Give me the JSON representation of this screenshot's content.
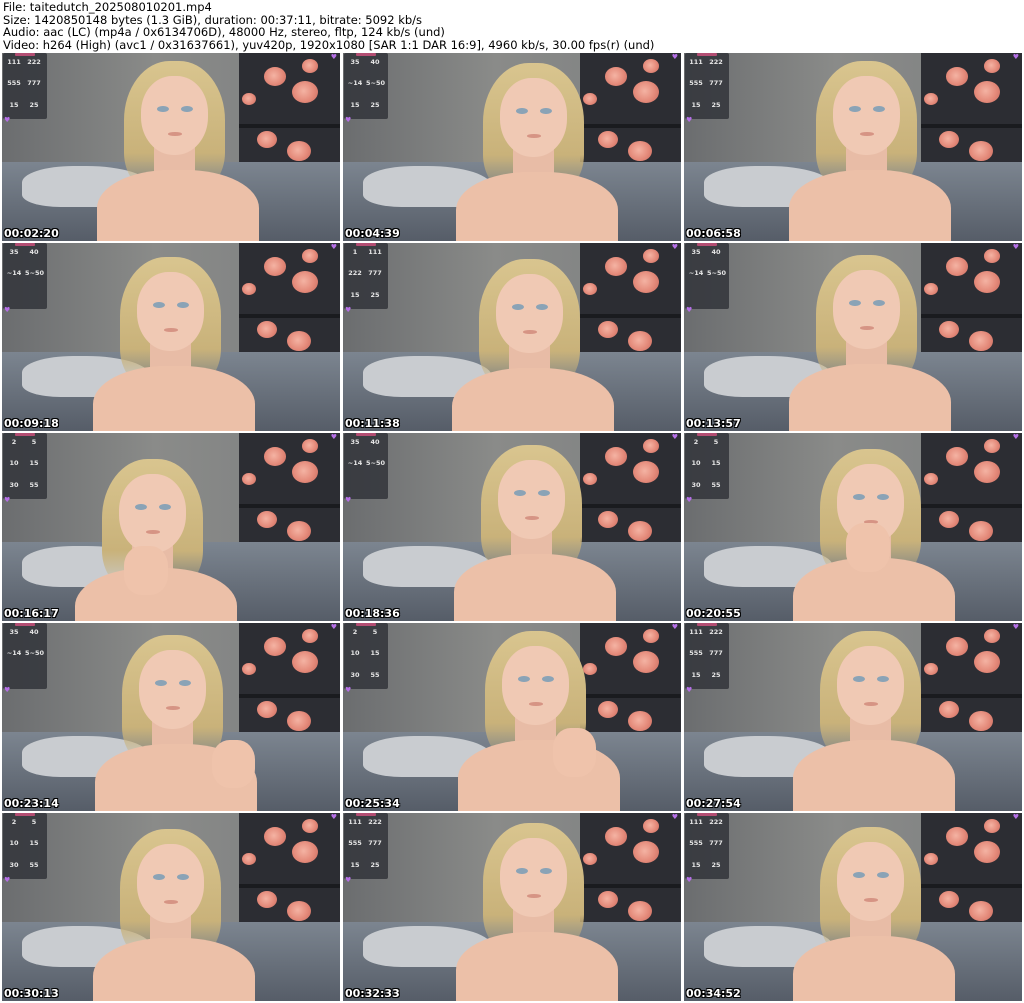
{
  "header": {
    "file": "File: taitedutch_202508010201.mp4",
    "size": "Size: 1420850148 bytes (1.3 GiB), duration: 00:37:11, bitrate: 5092 kb/s",
    "audio": "Audio: aac (LC) (mp4a / 0x6134706D), 48000 Hz, stereo, fltp, 124 kb/s (und)",
    "video": "Video: h264 (High) (avc1 / 0x31637661), yuv420p, 1920x1080 [SAR 1:1 DAR 16:9], 4960 kb/s, 30.00 fps(r) (und)"
  },
  "colors": {
    "timestamp": "#ffffff",
    "background": "#ffffff",
    "heart": "#b56fe6",
    "banner": "#b34e73"
  },
  "thumbnails": [
    {
      "time": "00:02:20",
      "panel": [
        "111",
        "222",
        "555",
        "777",
        "15",
        "25"
      ]
    },
    {
      "time": "00:04:39",
      "panel": [
        "35",
        "40",
        "~14",
        "5~50",
        "15",
        "25"
      ]
    },
    {
      "time": "00:06:58",
      "panel": [
        "111",
        "222",
        "555",
        "777",
        "15",
        "25"
      ]
    },
    {
      "time": "00:09:18",
      "panel": [
        "35",
        "40",
        "~14",
        "5~50",
        "",
        ""
      ]
    },
    {
      "time": "00:11:38",
      "panel": [
        "1",
        "111",
        "222",
        "777",
        "15",
        "25"
      ]
    },
    {
      "time": "00:13:57",
      "panel": [
        "35",
        "40",
        "~14",
        "5~50",
        "",
        ""
      ]
    },
    {
      "time": "00:16:17",
      "panel": [
        "2",
        "5",
        "10",
        "15",
        "30",
        "55"
      ]
    },
    {
      "time": "00:18:36",
      "panel": [
        "35",
        "40",
        "~14",
        "5~50",
        "",
        ""
      ]
    },
    {
      "time": "00:20:55",
      "panel": [
        "2",
        "5",
        "10",
        "15",
        "30",
        "55"
      ]
    },
    {
      "time": "00:23:14",
      "panel": [
        "35",
        "40",
        "~14",
        "5~50",
        "",
        ""
      ]
    },
    {
      "time": "00:25:34",
      "panel": [
        "2",
        "5",
        "10",
        "15",
        "30",
        "55"
      ]
    },
    {
      "time": "00:27:54",
      "panel": [
        "111",
        "222",
        "555",
        "777",
        "15",
        "25"
      ]
    },
    {
      "time": "00:30:13",
      "panel": [
        "2",
        "5",
        "10",
        "15",
        "30",
        "55"
      ]
    },
    {
      "time": "00:32:33",
      "panel": [
        "111",
        "222",
        "555",
        "777",
        "15",
        "25"
      ]
    },
    {
      "time": "00:34:52",
      "panel": [
        "111",
        "222",
        "555",
        "777",
        "15",
        "25"
      ]
    }
  ]
}
